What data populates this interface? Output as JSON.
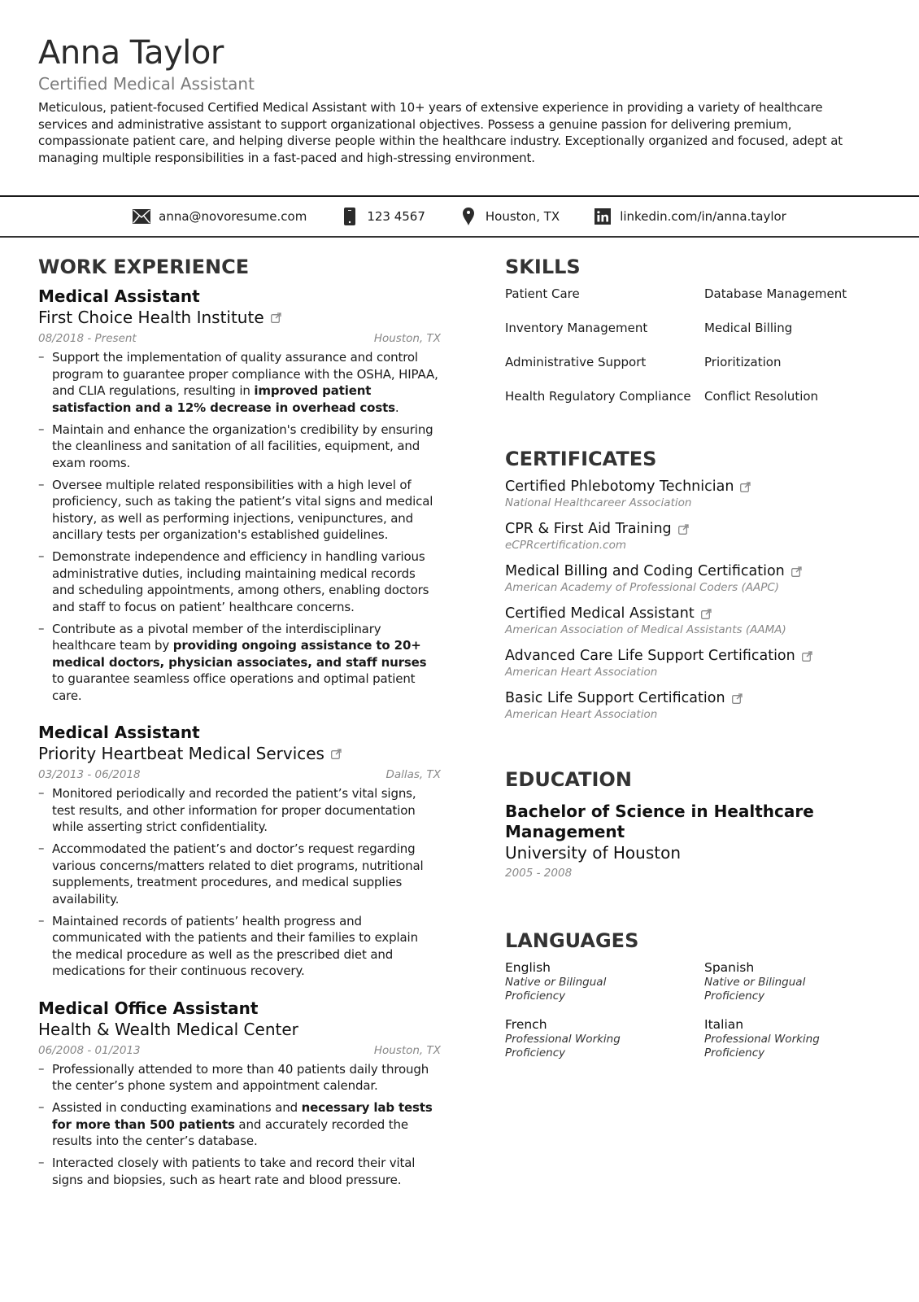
{
  "header": {
    "name": "Anna Taylor",
    "title": "Certified Medical Assistant",
    "summary": "Meticulous, patient-focused Certified Medical Assistant with 10+ years of extensive experience in providing a variety of healthcare services and administrative assistant to support organizational objectives. Possess a genuine passion for delivering premium, compassionate patient care, and helping diverse people within the healthcare industry. Exceptionally organized and focused, adept at managing multiple responsibilities in a fast-paced and high-stressing environment."
  },
  "contact": {
    "email": {
      "icon": "envelope-icon",
      "value": "anna@novoresume.com"
    },
    "phone": {
      "icon": "mobile-phone-icon",
      "value": "123 4567"
    },
    "location": {
      "icon": "map-pin-icon",
      "value": "Houston, TX"
    },
    "linkedin": {
      "icon": "linkedin-icon",
      "value": "linkedin.com/in/anna.taylor"
    }
  },
  "work": {
    "heading": "WORK EXPERIENCE",
    "jobs": [
      {
        "title": "Medical Assistant",
        "company": "First Choice Health Institute",
        "has_link": true,
        "dates": "08/2018 - Present",
        "location": "Houston, TX",
        "bullets": [
          [
            {
              "t": "Support the implementation of quality assurance and control program to guarantee proper compliance with the OSHA, HIPAA, and CLIA regulations, resulting in "
            },
            {
              "t": "improved patient satisfaction and a 12% decrease in overhead costs",
              "b": true
            },
            {
              "t": "."
            }
          ],
          [
            {
              "t": "Maintain and enhance the organization's credibility by ensuring the cleanliness and sanitation of all facilities, equipment, and exam rooms."
            }
          ],
          [
            {
              "t": "Oversee multiple related responsibilities with a high level of proficiency, such as taking the patient’s vital signs and medical history, as well as performing injections, venipunctures, and ancillary tests per organization's established guidelines."
            }
          ],
          [
            {
              "t": "Demonstrate independence and efficiency in handling various administrative duties, including maintaining medical records and scheduling appointments, among others, enabling doctors and staff to focus on patient’ healthcare concerns."
            }
          ],
          [
            {
              "t": "Contribute as a pivotal member of the interdisciplinary healthcare team by "
            },
            {
              "t": "providing ongoing assistance to 20+ medical doctors, physician associates, and staff nurses",
              "b": true
            },
            {
              "t": " to guarantee seamless office operations and optimal patient care."
            }
          ]
        ]
      },
      {
        "title": "Medical Assistant",
        "company": "Priority Heartbeat Medical Services",
        "has_link": true,
        "dates": "03/2013 - 06/2018",
        "location": "Dallas, TX",
        "bullets": [
          [
            {
              "t": "Monitored periodically and recorded the patient’s vital signs, test results, and other information for proper documentation while asserting strict confidentiality."
            }
          ],
          [
            {
              "t": "Accommodated the patient’s and doctor’s request regarding various concerns/matters related to diet programs, nutritional supplements, treatment procedures, and medical supplies availability."
            }
          ],
          [
            {
              "t": "Maintained records of patients’ health progress and communicated with the patients and their families to explain the medical procedure as well as the prescribed diet and medications for their continuous recovery."
            }
          ]
        ]
      },
      {
        "title": "Medical Office Assistant",
        "company": "Health & Wealth Medical Center",
        "has_link": false,
        "dates": "06/2008 - 01/2013",
        "location": "Houston, TX",
        "bullets": [
          [
            {
              "t": "Professionally attended to more than 40 patients daily through the center’s phone system and appointment calendar."
            }
          ],
          [
            {
              "t": "Assisted in conducting examinations and "
            },
            {
              "t": "necessary lab tests for more than 500 patients",
              "b": true
            },
            {
              "t": " and accurately recorded the results into the center’s database."
            }
          ],
          [
            {
              "t": "Interacted closely with patients to take and record their vital signs and biopsies, such as heart rate and blood pressure."
            }
          ]
        ]
      }
    ]
  },
  "skills": {
    "heading": "SKILLS",
    "items": [
      "Patient Care",
      "Database Management",
      "Inventory Management",
      "Medical Billing",
      "Administrative Support",
      "Prioritization",
      "Health Regulatory Compliance",
      "Conflict Resolution"
    ]
  },
  "certificates": {
    "heading": "CERTIFICATES",
    "items": [
      {
        "name": "Certified Phlebotomy Technician",
        "org": "National Healthcareer Association"
      },
      {
        "name": "CPR & First Aid Training",
        "org": "eCPRcertification.com"
      },
      {
        "name": "Medical Billing and Coding Certification",
        "org": "American Academy of Professional Coders (AAPC)"
      },
      {
        "name": "Certified Medical Assistant",
        "org": "American Association of Medical Assistants (AAMA)"
      },
      {
        "name": "Advanced Care Life Support Certification",
        "org": "American Heart Association"
      },
      {
        "name": "Basic Life Support Certification",
        "org": "American Heart Association"
      }
    ]
  },
  "education": {
    "heading": "EDUCATION",
    "degree": "Bachelor of Science in Healthcare Management",
    "school": "University of Houston",
    "dates": "2005 - 2008"
  },
  "languages": {
    "heading": "LANGUAGES",
    "items": [
      {
        "name": "English",
        "level": "Native or Bilingual Proficiency"
      },
      {
        "name": "Spanish",
        "level": "Native or Bilingual Proficiency"
      },
      {
        "name": "French",
        "level": "Professional Working Proficiency"
      },
      {
        "name": "Italian",
        "level": "Professional Working Proficiency"
      }
    ]
  }
}
